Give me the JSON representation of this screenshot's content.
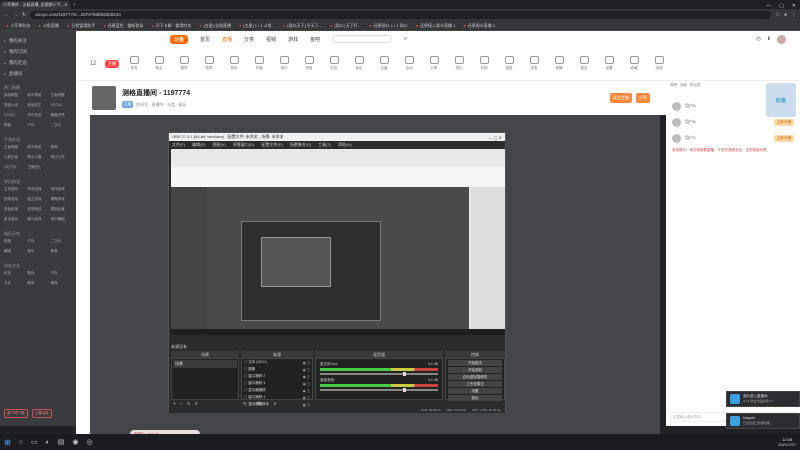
{
  "browser": {
    "tab_title": "小苹果杯 - 五级直播_伦妮斯人气...",
    "url": "douyu.com/1197774/...2074?9d5b9d29410",
    "bookmarks": [
      "小苹果科技",
      "斗鱼直播",
      "日程管理助手",
      "还原蓝色 · 重新登录",
      "开下卡解 · 看得的东",
      "[五星] 全网直播",
      "[五星] 1 / 1 斗鱼...",
      "[观众天下] 平天下...",
      "[观众] 天下打...",
      "还原观众 1 / 1 观众",
      "还原接入观众直播 1",
      "还原观众直播 1"
    ]
  },
  "site": {
    "logo": "斗鱼",
    "nav": [
      "首页",
      "直播",
      "分类",
      "视频",
      "游戏",
      "鱼吧"
    ],
    "nav_active": 1,
    "room_number": "12",
    "tools": [
      "任务",
      "鱼丸",
      "徽章",
      "勋章",
      "签到",
      "开播",
      "排行",
      "贵族",
      "红包",
      "粉丝",
      "主播",
      "活动",
      "分享",
      "送礼",
      "礼物",
      "抽奖",
      "连麦",
      "竞猜",
      "更多",
      "设置",
      "收藏",
      "消息"
    ],
    "badge": "开播",
    "room_title": "测格直播间 - 1197774",
    "room_sub": "房间号 · 直播中 · 分类 · 娱乐",
    "room_tag": "主播",
    "room_actions": [
      "关注主播",
      "分享"
    ],
    "sidebar_items": [
      "我的关注",
      "我的订阅",
      "我的足迹",
      "直播间"
    ],
    "sidebar_sections": [
      {
        "title": "热门直播",
        "items": [
          "英雄联盟",
          "和平精英",
          "王者荣耀",
          "穿越火线",
          "绝地求生",
          "DOTA2",
          "CS:GO",
          "炉石传说",
          "魔兽世界",
          "颜值",
          "户外",
          "二次元"
        ]
      },
      {
        "title": "手游休闲",
        "items": [
          "王者荣耀",
          "和平精英",
          "原神",
          "火影忍者",
          "第五人格",
          "明日方舟",
          "QQ飞车",
          "王牌战士"
        ]
      },
      {
        "title": "单机热游",
        "items": [
          "主机游戏",
          "怀旧游戏",
          "动作游戏",
          "恐怖游戏",
          "独立游戏",
          "策略游戏",
          "角色扮演",
          "体育竞技",
          "模拟经营",
          "射击游戏",
          "格斗游戏",
          "音乐舞蹈"
        ]
      },
      {
        "title": "娱乐天地",
        "items": [
          "颜值",
          "户外",
          "二次元",
          "舞蹈",
          "音乐",
          "美食"
        ]
      },
      {
        "title": "科技文化",
        "items": [
          "科技",
          "数码",
          "汽车",
          "文化",
          "教育",
          "萌宠"
        ]
      }
    ],
    "sidebar_bottom": [
      "客户端下载",
      "主播招募"
    ]
  },
  "obs": {
    "title": "OBS 27.0.1 (64-bit, windows) - 配置文件: 未命名 - 场景: 未命名",
    "menu": [
      "文件(F)",
      "编辑(E)",
      "视图(V)",
      "停靠窗口(D)",
      "配置文件(P)",
      "场景集合(S)",
      "工具(T)",
      "帮助(H)"
    ],
    "label_scene": "来源没有",
    "docks": {
      "scenes": "场景",
      "sources": "来源",
      "mixer": "混音器",
      "transitions": "转场",
      "controls": "控制"
    },
    "scenes": [
      "场景"
    ],
    "sources": [
      "文本 (GDI+)",
      "图像",
      "窗口捕获 2",
      "窗口捕获 3",
      "显示器捕获",
      "窗口捕获 4",
      "显示器捕获 2"
    ],
    "mixer": [
      {
        "name": "麦克风/Aux",
        "db": "0.0 dB"
      },
      {
        "name": "桌面音频",
        "db": "0.0 dB"
      }
    ],
    "controls": [
      "开始推流",
      "开始录制",
      "启动虚拟摄像机",
      "工作室模式",
      "设置",
      "退出"
    ],
    "status": [
      "LIVE: 00:00:00",
      "REC: 00:00:00",
      "CPU: 1.3%, 30.00 fps"
    ]
  },
  "right_panel": {
    "tabs": [
      "周榜",
      "贡献",
      "粉丝团"
    ],
    "ranks": [
      {
        "name": "用户A",
        "btn": "立即开通"
      },
      {
        "name": "用户B",
        "btn": "立即开通"
      },
      {
        "name": "用户C",
        "btn": "立即开通"
      }
    ],
    "notice": "系统提示：请文明观看直播，不发布违规言论，否则将被封禁。",
    "ad": "红鱼",
    "chat_placeholder": "这里输入聊天内容"
  },
  "taskbar": {
    "live_pill": "直播中 · Live 01",
    "time": "12:08",
    "date": "2021/7/27"
  },
  "notifications": [
    {
      "title": "观众进入直播间",
      "msg": "Q 11 欢迎光临的观众 1"
    },
    {
      "title": "Magnet",
      "msg": "已激活窗口管理功能"
    }
  ]
}
